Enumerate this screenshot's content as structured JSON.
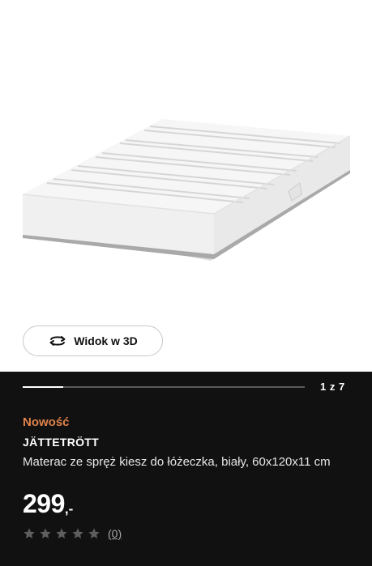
{
  "viewer": {
    "view3d_label": "Widok w 3D"
  },
  "carousel": {
    "progress_fraction": 0.143,
    "page_counter": "1 z 7"
  },
  "product": {
    "badge": "Nowość",
    "name": "JÄTTETRÖTT",
    "description": "Materac ze spręż kiesz do łóżeczka, biały, 60x120x11 cm",
    "price_integer": "299",
    "price_suffix": ",-",
    "rating_stars": 0,
    "rating_max": 5,
    "review_count": "(0)"
  },
  "colors": {
    "badge": "#e0824a",
    "background_dark": "#111111",
    "star_empty": "#5e5e5e"
  },
  "icons": {
    "view3d": "rotate-3d-icon",
    "star": "star-icon"
  }
}
